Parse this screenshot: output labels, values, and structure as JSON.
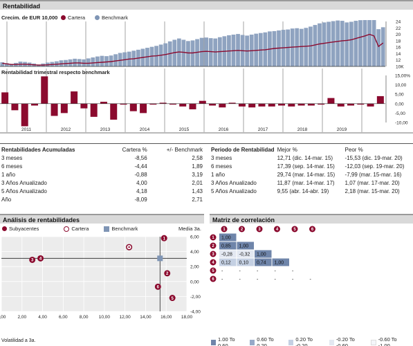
{
  "sections": {
    "rentabilidad": "Rentabilidad",
    "analisis": "Análisis de rentabilidades",
    "matriz": "Matriz de correlación"
  },
  "growth": {
    "label": "Crecim. de  EUR 10,000",
    "legend_cartera": "Cartera",
    "legend_benchmark": "Benchmark",
    "y_ticks": [
      "24",
      "22",
      "20",
      "18",
      "16",
      "14",
      "12",
      "10K"
    ]
  },
  "quarterly": {
    "label": "Rentabilidad trimestral respecto benchmark",
    "y_ticks": [
      "15,00%",
      "10,00",
      "5,00",
      "0,00",
      "-5,00",
      "-10,00"
    ],
    "years": [
      "2011",
      "2012",
      "2013",
      "2014",
      "2015",
      "2016",
      "2017",
      "2018",
      "2019"
    ]
  },
  "chart_data": [
    {
      "type": "bar",
      "title": "Crecim. de  EUR 10,000",
      "series": [
        {
          "name": "Benchmark",
          "values": [
            11.3,
            11.0,
            10.8,
            11.1,
            11.5,
            11.4,
            11.2,
            10.9,
            10.6,
            10.9,
            11.2,
            11.4,
            11.6,
            11.9,
            12.0,
            12.2,
            12.4,
            12.3,
            12.2,
            12.5,
            12.8,
            13.1,
            13.3,
            13.2,
            13.4,
            13.8,
            14.2,
            14.4,
            14.6,
            14.9,
            15.2,
            15.5,
            15.8,
            16.1,
            16.4,
            16.8,
            17.2,
            17.8,
            18.3,
            18.7,
            18.3,
            17.9,
            18.1,
            18.5,
            18.9,
            19.0,
            18.8,
            18.7,
            19.1,
            19.4,
            19.7,
            19.9,
            20.1,
            19.8,
            19.6,
            19.9,
            20.2,
            20.4,
            20.6,
            20.9,
            21.0,
            21.2,
            21.4,
            21.5,
            21.8,
            21.9,
            21.7,
            22.0,
            22.4,
            22.9,
            23.4,
            23.7,
            23.9,
            24.1,
            24.3,
            24.2,
            23.7,
            23.9,
            24.2,
            24.4,
            24.6,
            24.8,
            24.5,
            21.6,
            22.2
          ]
        },
        {
          "name": "Cartera",
          "values": [
            11.0,
            10.8,
            10.6,
            10.6,
            10.7,
            10.7,
            10.6,
            10.5,
            10.4,
            10.4,
            10.5,
            10.6,
            10.7,
            10.8,
            10.9,
            11.0,
            11.1,
            11.1,
            11.0,
            11.0,
            11.1,
            11.2,
            11.3,
            11.4,
            11.5,
            11.7,
            11.9,
            12.1,
            12.3,
            12.4,
            12.6,
            12.8,
            13.0,
            13.2,
            13.3,
            13.5,
            13.7,
            14.0,
            14.3,
            14.5,
            14.4,
            14.2,
            14.2,
            14.4,
            14.6,
            14.7,
            14.6,
            14.5,
            14.6,
            14.7,
            14.8,
            14.9,
            15.0,
            14.9,
            14.8,
            14.9,
            15.0,
            15.1,
            15.2,
            15.4,
            15.6,
            15.7,
            15.8,
            15.9,
            16.0,
            16.1,
            16.2,
            16.3,
            16.4,
            16.7,
            17.0,
            17.2,
            17.4,
            17.6,
            17.8,
            18.0,
            18.1,
            18.3,
            18.7,
            19.1,
            19.5,
            20.0,
            19.5,
            16.2,
            17.3
          ]
        }
      ],
      "ylim": [
        10,
        24
      ]
    },
    {
      "type": "bar",
      "title": "Rentabilidad trimestral respecto benchmark",
      "categories": [
        "2010Q3",
        "2010Q4",
        "2011Q1",
        "2011Q2",
        "2011Q3",
        "2011Q4",
        "2012Q1",
        "2012Q2",
        "2012Q3",
        "2012Q4",
        "2013Q1",
        "2013Q2",
        "2013Q3",
        "2013Q4",
        "2014Q1",
        "2014Q2",
        "2014Q3",
        "2014Q4",
        "2015Q1",
        "2015Q2",
        "2015Q3",
        "2015Q4",
        "2016Q1",
        "2016Q2",
        "2016Q3",
        "2016Q4",
        "2017Q1",
        "2017Q2",
        "2017Q3",
        "2017Q4",
        "2018Q1",
        "2018Q2",
        "2018Q3",
        "2018Q4",
        "2019Q1",
        "2019Q2",
        "2019Q3",
        "2019Q4",
        "2020Q1"
      ],
      "values": [
        6.0,
        -3.5,
        -12.0,
        -1.0,
        14.5,
        -6.5,
        -5.0,
        6.5,
        -2.5,
        -7.0,
        1.0,
        -8.5,
        -0.5,
        -4.0,
        -5.0,
        -0.5,
        0.5,
        -0.5,
        -1.5,
        -3.0,
        1.5,
        -1.0,
        -2.0,
        0.5,
        -1.5,
        -2.0,
        -1.5,
        -1.5,
        -1.0,
        -1.5,
        -1.0,
        -1.0,
        -0.5,
        3.0,
        -1.5,
        -1.0,
        -0.5,
        -1.5,
        4.0
      ],
      "ylim": [
        -10,
        15
      ]
    },
    {
      "type": "scatter",
      "xlabel": "Volatilidad a 3a.",
      "ylabel": "Media 3a.",
      "xlim": [
        0,
        18
      ],
      "ylim": [
        -4,
        6
      ],
      "points": [
        {
          "label": "1",
          "x": 15.8,
          "y": 5.8
        },
        {
          "label": "2",
          "x": 16.1,
          "y": 1.1
        },
        {
          "label": "3",
          "x": 3.0,
          "y": 2.9
        },
        {
          "label": "4",
          "x": 3.8,
          "y": 3.1
        },
        {
          "label": "5",
          "x": 16.6,
          "y": -2.2
        },
        {
          "label": "6",
          "x": 15.2,
          "y": -0.7
        },
        {
          "label": "Cartera",
          "x": 12.4,
          "y": 4.6
        },
        {
          "label": "Benchmark",
          "x": 15.4,
          "y": 3.1
        }
      ]
    }
  ],
  "scatter_ui": {
    "legend_sub": "Subyacentes",
    "legend_cartera": "Cartera",
    "legend_benchmark": "Benchmark",
    "ylabel": "Media 3a.",
    "xlabel": "Volatilidad a 3a.",
    "x_ticks": [
      "0,00",
      "2,00",
      "4,00",
      "6,00",
      "8,00",
      "10,00",
      "12,00",
      "14,00",
      "16,00",
      "18,00"
    ],
    "y_ticks": [
      "6,00",
      "4,00",
      "2,00",
      "0,00",
      "-2,00",
      "-4,00"
    ]
  },
  "acum": {
    "headers": [
      "Rentabilidades Acumuladas",
      "Cartera %",
      "+/- Benchmark"
    ],
    "rows": [
      [
        "3 meses",
        "-8,56",
        "2,58"
      ],
      [
        "6 meses",
        "-4,44",
        "1,89"
      ],
      [
        "1 año",
        "-0,88",
        "3,19"
      ],
      [
        "3 Años Anualizado",
        "4,00",
        "2,01"
      ],
      [
        "5 Años Anualizado",
        "4,18",
        "1,43"
      ],
      [
        "Año",
        "-8,09",
        "2,71"
      ]
    ]
  },
  "periodo": {
    "headers": [
      "Periodo de Rentabilidad",
      "Mejor %",
      "Peor %"
    ],
    "rows": [
      [
        "3 meses",
        "12,71 (dic. 14-mar. 15)",
        "-15,53 (dic. 19-mar. 20)"
      ],
      [
        "6 meses",
        "17,39 (sep. 14-mar. 15)",
        "-12,03 (sep. 19-mar. 20)"
      ],
      [
        "1 año",
        "29,74 (mar. 14-mar. 15)",
        "-7,99 (mar. 15-mar. 16)"
      ],
      [
        "3 Años Anualizado",
        "11,87 (mar. 14-mar. 17)",
        "1,07 (mar. 17-mar. 20)"
      ],
      [
        "5 Años Anualizado",
        "9,55 (abr. 14-abr. 19)",
        "2,18 (mar. 15-mar. 20)"
      ]
    ]
  },
  "corr": {
    "labels": [
      "1",
      "2",
      "3",
      "4",
      "5",
      "6"
    ],
    "rows": [
      [
        "1,00"
      ],
      [
        "0,85",
        "1,00"
      ],
      [
        "-0,28",
        "-0,32",
        "1,00"
      ],
      [
        "0,12",
        "0,10",
        "0,74",
        "1,00"
      ],
      [
        "-",
        "-",
        "-",
        "-",
        "-"
      ],
      [
        "-",
        "-",
        "-",
        "-",
        "-",
        "-"
      ]
    ],
    "legend": [
      "1.00 To 0.60",
      "0.60 To 0.20",
      "0.20 To -0.20",
      "-0.20 To -0.60",
      "-0.60 To -1.00"
    ]
  },
  "colors": {
    "cartera": "#8b0a2e",
    "benchmark": "#7f95b5",
    "benchmark_bar": "#8fa3c0",
    "header_bg": "#d9d9d9",
    "scatter_bg": "#ececec"
  }
}
